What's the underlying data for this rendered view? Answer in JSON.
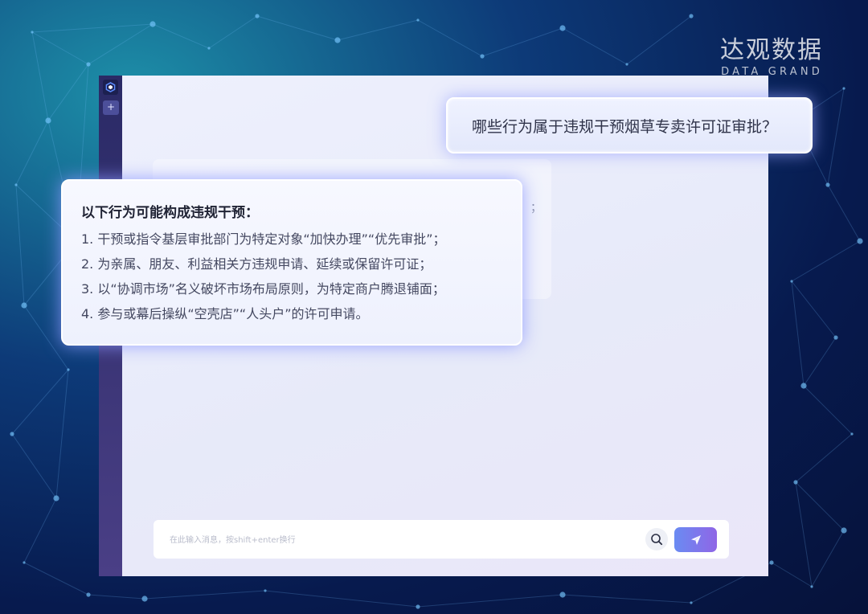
{
  "brand": {
    "name_cn": "达观数据",
    "name_en": "DATA GRAND"
  },
  "sidebar": {
    "new_chat_label": "+"
  },
  "chat": {
    "user_question": "哪些行为属于违规干预烟草专卖许可证审批？",
    "answer": {
      "title": "以下行为可能构成违规干预：",
      "items": [
        "1. 干预或指令基层审批部门为特定对象“加快办理”“优先审批”；",
        "2. 为亲属、朋友、利益相关方违规申请、延续或保留许可证；",
        "3. 以“协调市场”名义破坏市场布局原则，为特定商户腾退铺面；",
        "4. 参与或幕后操纵“空壳店”“人头户”的许可申请。"
      ]
    },
    "background_fragment": "；"
  },
  "input": {
    "placeholder": "在此输入消息，按shift+enter换行",
    "value": ""
  },
  "colors": {
    "accent_gradient_start": "#6a8bf2",
    "accent_gradient_end": "#8f66e6",
    "sidebar": "#2a2a66",
    "panel": "#eef0fd"
  },
  "icons": {
    "logo": "hexagon-logo-icon",
    "search": "search-icon",
    "send": "send-icon",
    "new": "plus-icon"
  }
}
